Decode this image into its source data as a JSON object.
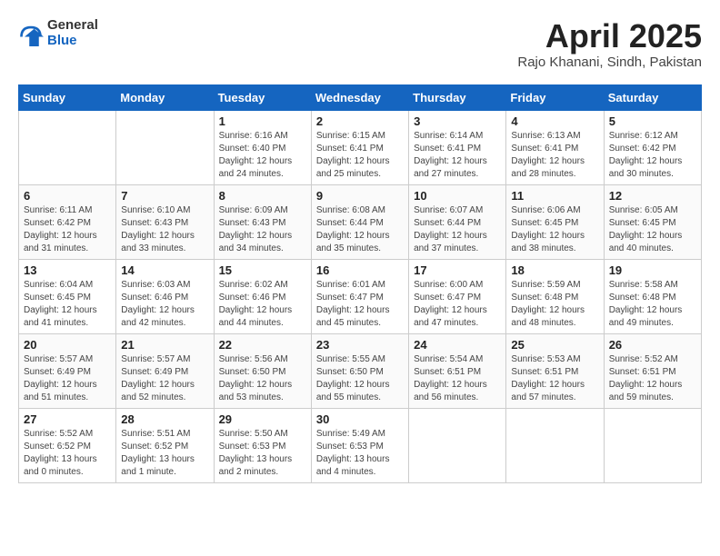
{
  "logo": {
    "general": "General",
    "blue": "Blue"
  },
  "header": {
    "title": "April 2025",
    "subtitle": "Rajo Khanani, Sindh, Pakistan"
  },
  "weekdays": [
    "Sunday",
    "Monday",
    "Tuesday",
    "Wednesday",
    "Thursday",
    "Friday",
    "Saturday"
  ],
  "weeks": [
    [
      null,
      null,
      {
        "day": 1,
        "sunrise": "6:16 AM",
        "sunset": "6:40 PM",
        "daylight": "12 hours and 24 minutes."
      },
      {
        "day": 2,
        "sunrise": "6:15 AM",
        "sunset": "6:41 PM",
        "daylight": "12 hours and 25 minutes."
      },
      {
        "day": 3,
        "sunrise": "6:14 AM",
        "sunset": "6:41 PM",
        "daylight": "12 hours and 27 minutes."
      },
      {
        "day": 4,
        "sunrise": "6:13 AM",
        "sunset": "6:41 PM",
        "daylight": "12 hours and 28 minutes."
      },
      {
        "day": 5,
        "sunrise": "6:12 AM",
        "sunset": "6:42 PM",
        "daylight": "12 hours and 30 minutes."
      }
    ],
    [
      {
        "day": 6,
        "sunrise": "6:11 AM",
        "sunset": "6:42 PM",
        "daylight": "12 hours and 31 minutes."
      },
      {
        "day": 7,
        "sunrise": "6:10 AM",
        "sunset": "6:43 PM",
        "daylight": "12 hours and 33 minutes."
      },
      {
        "day": 8,
        "sunrise": "6:09 AM",
        "sunset": "6:43 PM",
        "daylight": "12 hours and 34 minutes."
      },
      {
        "day": 9,
        "sunrise": "6:08 AM",
        "sunset": "6:44 PM",
        "daylight": "12 hours and 35 minutes."
      },
      {
        "day": 10,
        "sunrise": "6:07 AM",
        "sunset": "6:44 PM",
        "daylight": "12 hours and 37 minutes."
      },
      {
        "day": 11,
        "sunrise": "6:06 AM",
        "sunset": "6:45 PM",
        "daylight": "12 hours and 38 minutes."
      },
      {
        "day": 12,
        "sunrise": "6:05 AM",
        "sunset": "6:45 PM",
        "daylight": "12 hours and 40 minutes."
      }
    ],
    [
      {
        "day": 13,
        "sunrise": "6:04 AM",
        "sunset": "6:45 PM",
        "daylight": "12 hours and 41 minutes."
      },
      {
        "day": 14,
        "sunrise": "6:03 AM",
        "sunset": "6:46 PM",
        "daylight": "12 hours and 42 minutes."
      },
      {
        "day": 15,
        "sunrise": "6:02 AM",
        "sunset": "6:46 PM",
        "daylight": "12 hours and 44 minutes."
      },
      {
        "day": 16,
        "sunrise": "6:01 AM",
        "sunset": "6:47 PM",
        "daylight": "12 hours and 45 minutes."
      },
      {
        "day": 17,
        "sunrise": "6:00 AM",
        "sunset": "6:47 PM",
        "daylight": "12 hours and 47 minutes."
      },
      {
        "day": 18,
        "sunrise": "5:59 AM",
        "sunset": "6:48 PM",
        "daylight": "12 hours and 48 minutes."
      },
      {
        "day": 19,
        "sunrise": "5:58 AM",
        "sunset": "6:48 PM",
        "daylight": "12 hours and 49 minutes."
      }
    ],
    [
      {
        "day": 20,
        "sunrise": "5:57 AM",
        "sunset": "6:49 PM",
        "daylight": "12 hours and 51 minutes."
      },
      {
        "day": 21,
        "sunrise": "5:57 AM",
        "sunset": "6:49 PM",
        "daylight": "12 hours and 52 minutes."
      },
      {
        "day": 22,
        "sunrise": "5:56 AM",
        "sunset": "6:50 PM",
        "daylight": "12 hours and 53 minutes."
      },
      {
        "day": 23,
        "sunrise": "5:55 AM",
        "sunset": "6:50 PM",
        "daylight": "12 hours and 55 minutes."
      },
      {
        "day": 24,
        "sunrise": "5:54 AM",
        "sunset": "6:51 PM",
        "daylight": "12 hours and 56 minutes."
      },
      {
        "day": 25,
        "sunrise": "5:53 AM",
        "sunset": "6:51 PM",
        "daylight": "12 hours and 57 minutes."
      },
      {
        "day": 26,
        "sunrise": "5:52 AM",
        "sunset": "6:51 PM",
        "daylight": "12 hours and 59 minutes."
      }
    ],
    [
      {
        "day": 27,
        "sunrise": "5:52 AM",
        "sunset": "6:52 PM",
        "daylight": "13 hours and 0 minutes."
      },
      {
        "day": 28,
        "sunrise": "5:51 AM",
        "sunset": "6:52 PM",
        "daylight": "13 hours and 1 minute."
      },
      {
        "day": 29,
        "sunrise": "5:50 AM",
        "sunset": "6:53 PM",
        "daylight": "13 hours and 2 minutes."
      },
      {
        "day": 30,
        "sunrise": "5:49 AM",
        "sunset": "6:53 PM",
        "daylight": "13 hours and 4 minutes."
      },
      null,
      null,
      null
    ]
  ],
  "labels": {
    "sunrise": "Sunrise:",
    "sunset": "Sunset:",
    "daylight": "Daylight:"
  }
}
